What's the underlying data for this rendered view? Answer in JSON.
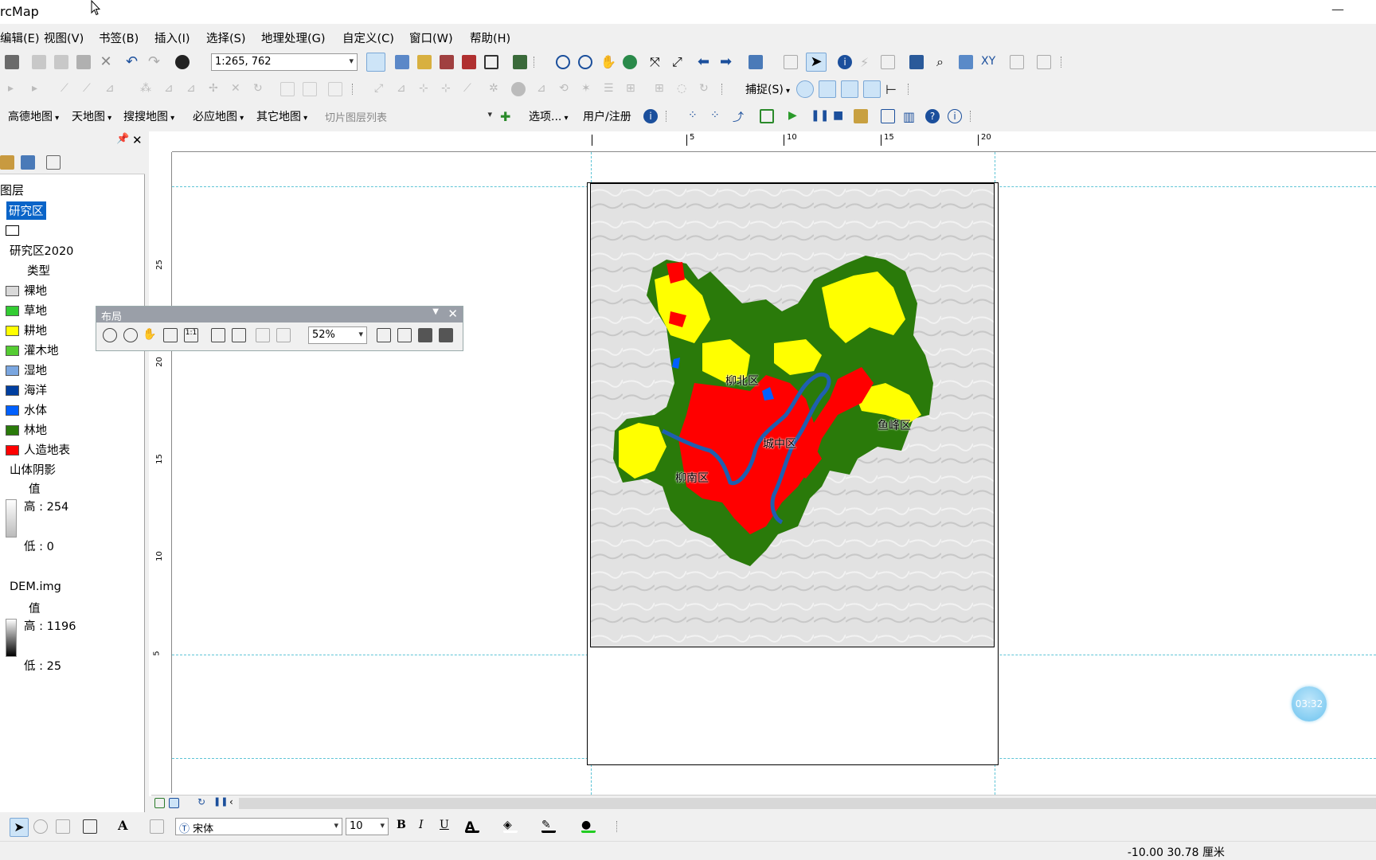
{
  "app": {
    "title": "rcMap",
    "minimize": "—"
  },
  "menu": [
    "编辑(E)",
    "视图(V)",
    "书签(B)",
    "插入(I)",
    "选择(S)",
    "地理处理(G)",
    "自定义(C)",
    "窗口(W)",
    "帮助(H)"
  ],
  "toolbar1": {
    "scale": "1:265, 762"
  },
  "toolbar2": {
    "snap_label": "捕捉(S)"
  },
  "toolbar3": {
    "basemaps": [
      "高德地图",
      "天地图",
      "搜搜地图",
      "必应地图",
      "其它地图"
    ],
    "tile_placeholder": "切片图层列表",
    "options": "选项...",
    "user": "用户/注册"
  },
  "toc": {
    "title": "图层",
    "layers": [
      {
        "name": "研究区",
        "selected": true
      },
      {
        "name": "研究区2020",
        "field": "类型",
        "classes": [
          {
            "label": "裸地",
            "color": "#d9d9d9"
          },
          {
            "label": "草地",
            "color": "#33cc33"
          },
          {
            "label": "耕地",
            "color": "#ffff00"
          },
          {
            "label": "灌木地",
            "color": "#55cc33"
          },
          {
            "label": "湿地",
            "color": "#7aa6e0"
          },
          {
            "label": "海洋",
            "color": "#003fa0"
          },
          {
            "label": "水体",
            "color": "#0060ff"
          },
          {
            "label": "林地",
            "color": "#2a7a0a"
          },
          {
            "label": "人造地表",
            "color": "#ff0000"
          }
        ]
      },
      {
        "name": "山体阴影",
        "field": "值",
        "high": "高 : 254",
        "low": "低 : 0"
      },
      {
        "name": "DEM.img",
        "field": "值",
        "high": "高 : 1196",
        "low": "低 : 25"
      }
    ]
  },
  "ruler": {
    "h_ticks": [
      "5",
      "10",
      "15",
      "20"
    ],
    "v_ticks": [
      "25",
      "20",
      "15",
      "10",
      "5"
    ]
  },
  "map": {
    "districts": [
      "柳北区",
      "城中区",
      "鱼峰区",
      "柳南区"
    ]
  },
  "layout_toolbar": {
    "title": "布局",
    "zoom": "52%"
  },
  "draw": {
    "font": "宋体",
    "size": "10",
    "bold": "B",
    "italic": "I",
    "underline": "U",
    "text_a": "A"
  },
  "status": {
    "coords": "-10.00  30.78 厘米"
  },
  "timer": "03:32"
}
